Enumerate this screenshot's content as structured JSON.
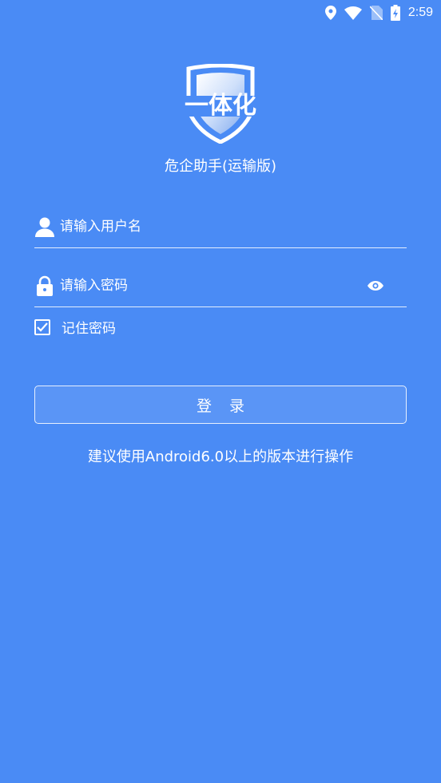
{
  "status_bar": {
    "time": "2:59",
    "icons": [
      "location-icon",
      "wifi-icon",
      "no-signal-icon",
      "battery-charging-icon"
    ]
  },
  "app": {
    "logo_text": "一体化",
    "subtitle": "危企助手(运输版)"
  },
  "form": {
    "username": {
      "placeholder": "请输入用户名",
      "value": "",
      "icon": "user-icon"
    },
    "password": {
      "placeholder": "请输入密码",
      "value": "",
      "icon": "lock-icon",
      "toggle_icon": "eye-icon"
    },
    "remember": {
      "label": "记住密码",
      "checked": true
    },
    "login_label": "登录"
  },
  "hint": "建议使用Android6.0以上的版本进行操作",
  "colors": {
    "background": "#4a8bf5",
    "button": "#5a95f6",
    "text": "#ffffff"
  }
}
